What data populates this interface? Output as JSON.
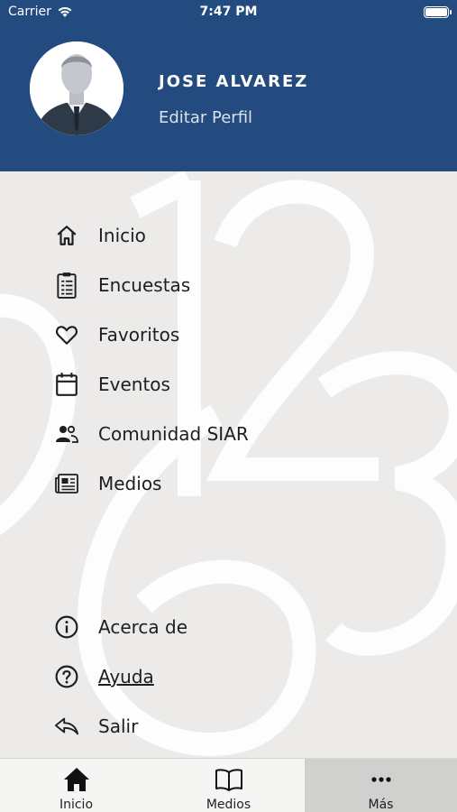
{
  "status_bar": {
    "carrier": "Carrier",
    "time": "7:47 PM"
  },
  "profile": {
    "name": "JOSE ALVAREZ",
    "edit_label": "Editar Perfil"
  },
  "menu": {
    "items": [
      {
        "label": "Inicio",
        "icon": "home-icon"
      },
      {
        "label": "Encuestas",
        "icon": "clipboard-icon"
      },
      {
        "label": "Favoritos",
        "icon": "heart-icon"
      },
      {
        "label": "Eventos",
        "icon": "calendar-icon"
      },
      {
        "label": "Comunidad SIAR",
        "icon": "people-icon"
      },
      {
        "label": "Medios",
        "icon": "newspaper-icon"
      }
    ],
    "secondary": [
      {
        "label": "Acerca de",
        "icon": "info-icon"
      },
      {
        "label": "Ayuda",
        "icon": "help-icon"
      },
      {
        "label": "Salir",
        "icon": "reply-icon"
      }
    ]
  },
  "tabs": [
    {
      "label": "Inicio",
      "icon": "home-icon"
    },
    {
      "label": "Medios",
      "icon": "book-icon"
    },
    {
      "label": "Más",
      "icon": "more-icon",
      "active": true
    }
  ],
  "colors": {
    "header": "#234b7f",
    "background": "#ecebe9",
    "active_tab": "#d0d0ce"
  }
}
